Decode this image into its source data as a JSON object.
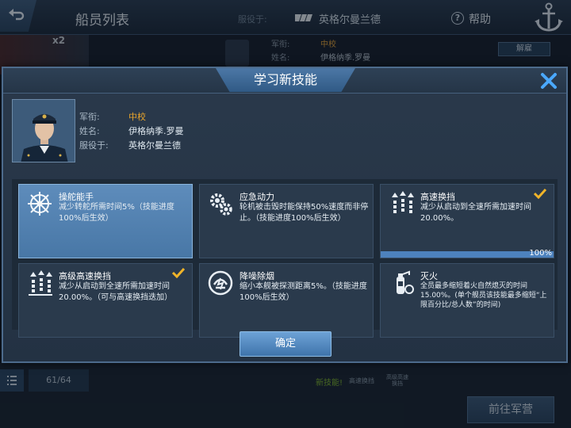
{
  "header": {
    "title": "船员列表",
    "serve_label": "服役于:",
    "ship_name": "英格尔曼兰德",
    "help_label": "帮助"
  },
  "background": {
    "ship_level": "x2",
    "rank_label": "军衔:",
    "rank_value": "中校",
    "name_label": "姓名:",
    "name_value": "伊格纳季.罗曼",
    "release_label": "解雇",
    "crew_count": "61/64",
    "new_skill_label": "新技能!",
    "speed_label": "高速换挡",
    "speed2_label": "高级高速换挡",
    "camp_button": "前往军营"
  },
  "dialog": {
    "title": "学习新技能",
    "officer": {
      "rank_label": "军衔:",
      "rank_value": "中校",
      "name_label": "姓名:",
      "name_value": "伊格纳季.罗曼",
      "serve_label": "服役于:",
      "serve_value": "英格尔曼兰德"
    },
    "skills": [
      {
        "name": "操舵能手",
        "desc": "减少转舵所需时间5%（技能进度100%后生效）",
        "selected": true,
        "icon": "helm-icon"
      },
      {
        "name": "应急动力",
        "desc": "轮机被击毁时能保持50%速度而非停止。（技能进度100%后生效）",
        "selected": false,
        "icon": "gears-icon"
      },
      {
        "name": "高速换挡",
        "desc": "减少从启动到全速所需加速时间20.00%。",
        "selected": false,
        "icon": "speed-icon",
        "learned": true,
        "progress": 100,
        "progress_label": "100%"
      },
      {
        "name": "高级高速换挡",
        "desc": "减少从启动到全速所需加速时间20.00%。（可与高速换挡迭加）",
        "selected": false,
        "icon": "speed-advanced-icon",
        "learned": true
      },
      {
        "name": "降噪除烟",
        "desc": "缩小本舰被探测距离5%。（技能进度100%后生效）",
        "selected": false,
        "icon": "stealth-icon"
      },
      {
        "name": "灭火",
        "desc": "全员最多缩短着火自然熄灭的时间15.00%。(单个舰员该技能最多缩短“上限百分比/总人数”的时间)",
        "selected": false,
        "icon": "extinguisher-icon"
      }
    ],
    "confirm_label": "确定"
  },
  "colors": {
    "accent": "#4d82bd",
    "rank": "#e8a42c",
    "check": "#f0b429",
    "new_skill": "#7fb42e"
  }
}
